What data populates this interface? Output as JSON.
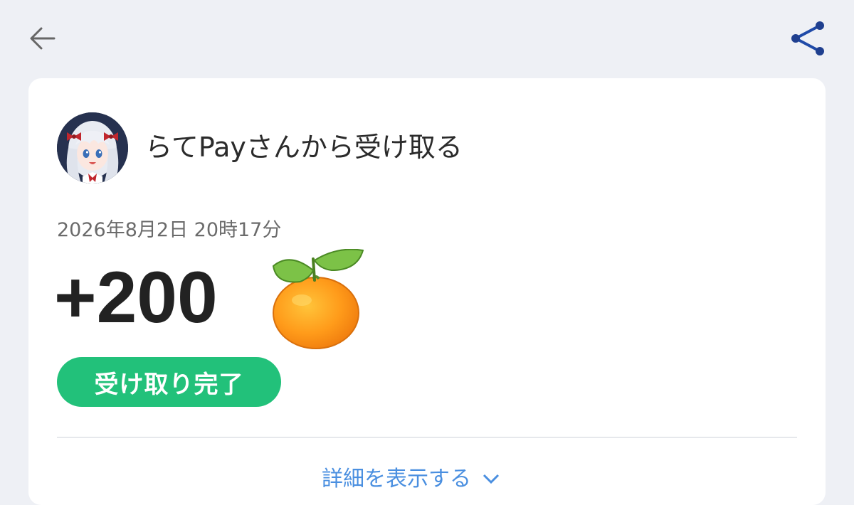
{
  "header": {
    "back_icon": "arrow-left-icon",
    "share_icon": "share-icon",
    "icon_color": "#666666",
    "share_color": "#1f4aa8"
  },
  "transaction": {
    "avatar": "anime-character-avatar",
    "sender_title": "らてPayさんから受け取る",
    "timestamp": "2026年8月2日 20時17分",
    "amount": "+200",
    "currency_icon": "tangerine-icon",
    "status_label": "受け取り完了",
    "status_color": "#22c17a",
    "details_label": "詳細を表示する",
    "details_icon": "chevron-down-icon",
    "link_color": "#4a8fe0"
  }
}
